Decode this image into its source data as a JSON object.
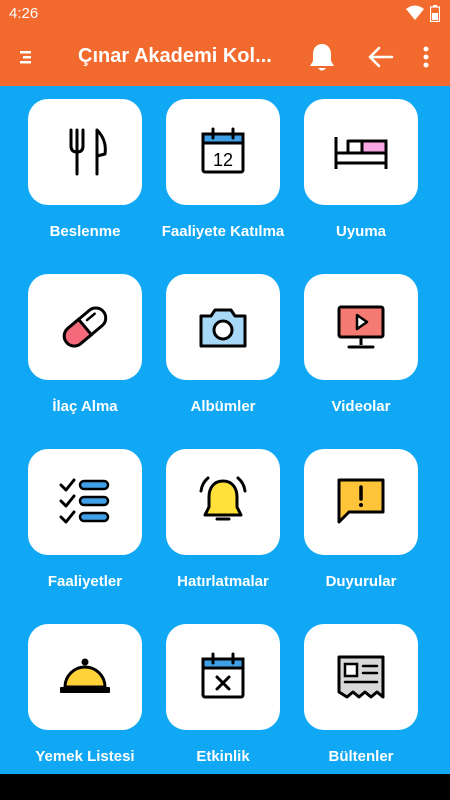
{
  "status_bar": {
    "time": "4:26"
  },
  "app_bar": {
    "title": "Çınar Akademi Kol...",
    "menu_icon": "menu-icon",
    "bell_icon": "bell-icon",
    "back_icon": "arrow-back-icon",
    "more_icon": "more-vert-icon"
  },
  "colors": {
    "app_bar": "#f26a2e",
    "background": "#10a8f4",
    "tile": "#ffffff"
  },
  "tiles": [
    {
      "label": "Beslenme",
      "icon": "fork-knife-icon"
    },
    {
      "label": "Faaliyete Katılma",
      "icon": "calendar-12-icon"
    },
    {
      "label": "Uyuma",
      "icon": "bed-icon"
    },
    {
      "label": "İlaç Alma",
      "icon": "pill-icon"
    },
    {
      "label": "Albümler",
      "icon": "camera-icon"
    },
    {
      "label": "Videolar",
      "icon": "video-play-icon"
    },
    {
      "label": "Faaliyetler",
      "icon": "checklist-icon"
    },
    {
      "label": "Hatırlatmalar",
      "icon": "alarm-bell-icon"
    },
    {
      "label": "Duyurular",
      "icon": "announcement-icon"
    },
    {
      "label": "Yemek Listesi",
      "icon": "food-cloche-icon"
    },
    {
      "label": "Etkinlik",
      "icon": "calendar-x-icon"
    },
    {
      "label": "Bültenler",
      "icon": "newsletter-icon"
    }
  ]
}
